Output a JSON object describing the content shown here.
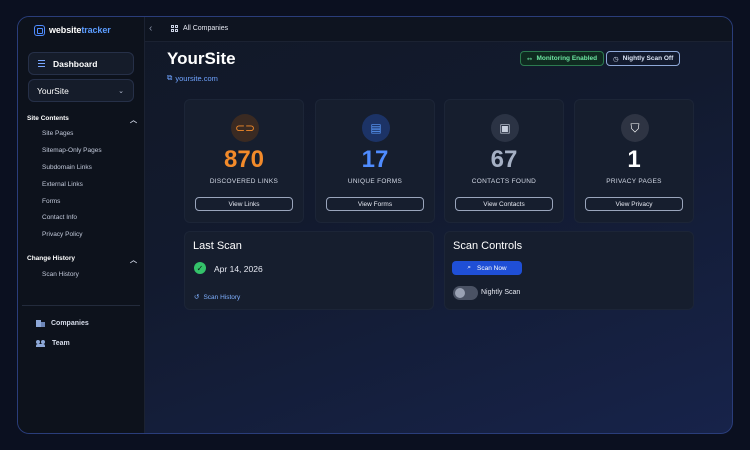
{
  "brand": {
    "name_part1": "website",
    "name_part2": "tracker"
  },
  "topbar": {
    "breadcrumb": "All Companies"
  },
  "sidebar": {
    "dashboard_label": "Dashboard",
    "site_selector": "YourSite",
    "sections": [
      {
        "title": "Site Contents",
        "items": [
          "Site Pages",
          "Sitemap-Only Pages",
          "Subdomain Links",
          "External Links",
          "Forms",
          "Contact Info",
          "Privacy Policy"
        ]
      },
      {
        "title": "Change History",
        "items": [
          "Scan History"
        ]
      }
    ],
    "bottom": {
      "companies": "Companies",
      "team": "Team"
    }
  },
  "header": {
    "site_name": "YourSite",
    "site_url": "yoursite.com",
    "badges": {
      "monitoring": "Monitoring Enabled",
      "nightly": "Nightly Scan Off"
    }
  },
  "stats": [
    {
      "value": "870",
      "label": "DISCOVERED LINKS",
      "button": "View Links",
      "color": "#f28a2a",
      "icon": "link-icon"
    },
    {
      "value": "17",
      "label": "UNIQUE FORMS",
      "button": "View Forms",
      "color": "#4f8cff",
      "icon": "document-icon"
    },
    {
      "value": "67",
      "label": "CONTACTS FOUND",
      "button": "View Contacts",
      "color": "#a5b0c4",
      "icon": "contact-card-icon"
    },
    {
      "value": "1",
      "label": "PRIVACY PAGES",
      "button": "View Privacy",
      "color": "#ffffff",
      "icon": "shield-icon"
    }
  ],
  "last_scan": {
    "title": "Last Scan",
    "date": "Apr 14, 2026",
    "history_link": "Scan History"
  },
  "scan_controls": {
    "title": "Scan Controls",
    "scan_now": "Scan Now",
    "nightly_label": "Nightly Scan",
    "nightly_enabled": false
  }
}
